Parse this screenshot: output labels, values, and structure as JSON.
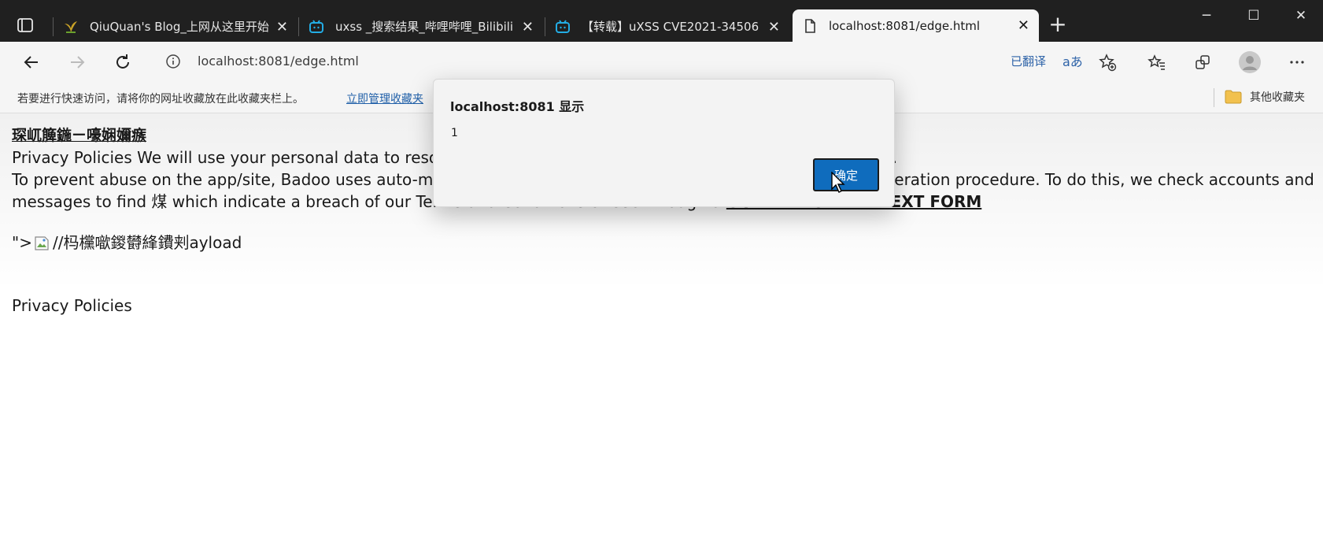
{
  "tabs": [
    {
      "title": "QiuQuan's Blog_上网从这里开始",
      "icon": "plant-favicon-icon"
    },
    {
      "title": "uxss _搜索结果_哔哩哔哩_Bilibili",
      "icon": "bilibili-tv-icon"
    },
    {
      "title": "【转载】uXSS CVE2021-34506 C",
      "icon": "bilibili-tv-icon"
    },
    {
      "title": "localhost:8081/edge.html",
      "icon": "page-icon",
      "active": true
    }
  ],
  "toolbar": {
    "url": "localhost:8081/edge.html",
    "translated_label": "已翻译",
    "translate_glyph": "aあ"
  },
  "favorites_bar": {
    "hint": "若要进行快速访问，请将你的网址收藏放在此收藏夹栏上。",
    "manage_link": "立即管理收藏夹",
    "other_favorites": "其他收藏夹"
  },
  "page": {
    "heading": "琛屼簲鍦ㄧ嚎娴嬭瘯",
    "p1_text": "Privacy Policies We will use your personal data to resolve disputes and enforce our Terms and Conditions of Use.",
    "p2_text": "To prevent abuse on the app/site, Badoo uses auto-mated systems and a team of moderators as part of its moderation procedure. To do this, we check accounts and messages to find 煤 which indicate a breach of our Terms and Conditions of Use through a",
    "p2_bold": "OUR PAYLOAD IN TEXT FORM",
    "payload_prefix": "\">",
    "payload_suffix": " //杩欓噷鍐欎綘鐨刾ayload",
    "p3_text": "Privacy Policies"
  },
  "dialog": {
    "title": "localhost:8081 显示",
    "message": "1",
    "ok_label": "确定"
  },
  "colors": {
    "tabstrip_bg": "#202020",
    "toolbar_bg": "#f5f5f5",
    "accent": "#0f6cbd",
    "link": "#1f5fa8"
  }
}
